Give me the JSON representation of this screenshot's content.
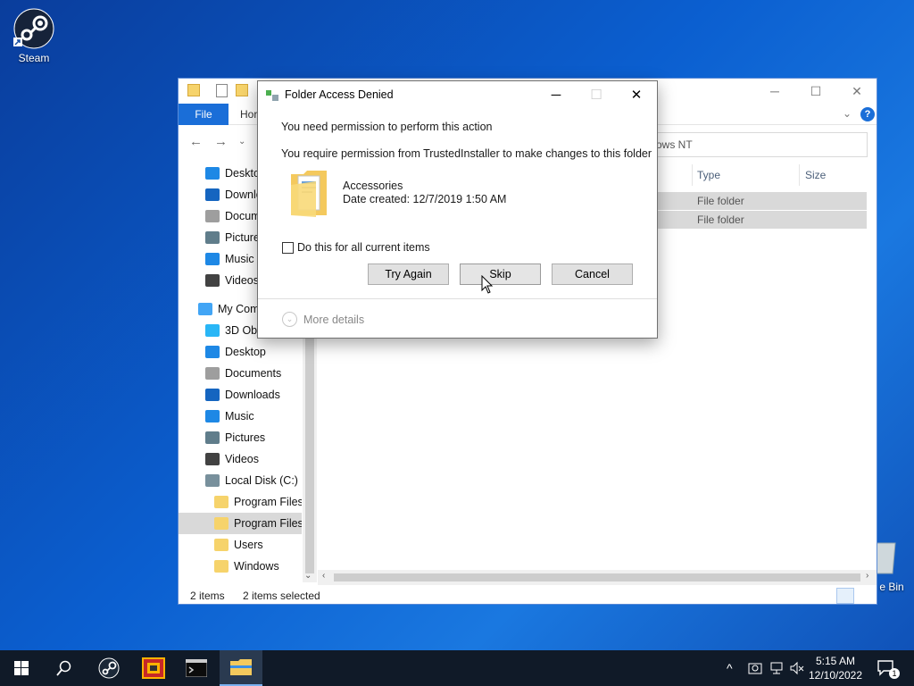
{
  "desktop": {
    "icons": [
      {
        "label": "Steam"
      },
      {
        "label": "e Bin"
      }
    ]
  },
  "explorer": {
    "tabs": {
      "file": "File",
      "home": "Hor"
    },
    "address_partial": "ows NT",
    "columns": {
      "type": "Type",
      "size": "Size"
    },
    "rows": [
      {
        "type": "File folder"
      },
      {
        "type": "File folder"
      }
    ],
    "sidebar": [
      {
        "label": "Deskto",
        "icon": "desktop-icon",
        "color": "#1e88e5"
      },
      {
        "label": "Downlo",
        "icon": "download-icon",
        "color": "#1565c0"
      },
      {
        "label": "Docum",
        "icon": "document-icon",
        "color": "#9e9e9e"
      },
      {
        "label": "Picture",
        "icon": "pictures-icon",
        "color": "#607d8b"
      },
      {
        "label": "Music",
        "icon": "music-icon",
        "color": "#1e88e5"
      },
      {
        "label": "Videos",
        "icon": "video-icon",
        "color": "#424242"
      },
      {
        "label": "My Com",
        "icon": "computer-icon",
        "color": "#42a5f5"
      },
      {
        "label": "3D Obj",
        "icon": "3d-objects-icon",
        "color": "#29b6f6"
      },
      {
        "label": "Desktop",
        "icon": "desktop-icon",
        "color": "#1e88e5"
      },
      {
        "label": "Documents",
        "icon": "document-icon",
        "color": "#9e9e9e"
      },
      {
        "label": "Downloads",
        "icon": "download-icon",
        "color": "#1565c0"
      },
      {
        "label": "Music",
        "icon": "music-icon",
        "color": "#1e88e5"
      },
      {
        "label": "Pictures",
        "icon": "pictures-icon",
        "color": "#607d8b"
      },
      {
        "label": "Videos",
        "icon": "video-icon",
        "color": "#424242"
      },
      {
        "label": "Local Disk (C:)",
        "icon": "drive-icon",
        "color": "#78909c"
      },
      {
        "label": "Program Files",
        "icon": "folder-icon",
        "color": "#f6d36b"
      },
      {
        "label": "Program Files (",
        "icon": "folder-icon",
        "color": "#f6d36b"
      },
      {
        "label": "Users",
        "icon": "folder-icon",
        "color": "#f6d36b"
      },
      {
        "label": "Windows",
        "icon": "folder-icon",
        "color": "#f6d36b"
      }
    ],
    "status": {
      "count": "2 items",
      "selected": "2 items selected"
    }
  },
  "dialog": {
    "title": "Folder Access Denied",
    "heading": "You need permission to perform this action",
    "message": "You require permission from TrustedInstaller to make changes to this folder",
    "item_name": "Accessories",
    "item_date": "Date created: 12/7/2019 1:50 AM",
    "checkbox_label": "Do this for all current items",
    "buttons": {
      "try_again": "Try Again",
      "skip": "Skip",
      "cancel": "Cancel"
    },
    "more_details": "More details"
  },
  "taskbar": {
    "time": "5:15 AM",
    "date": "12/10/2022",
    "notification_count": "1"
  },
  "colors": {
    "accent": "#1a6ed8",
    "taskbar": "#101a28"
  }
}
